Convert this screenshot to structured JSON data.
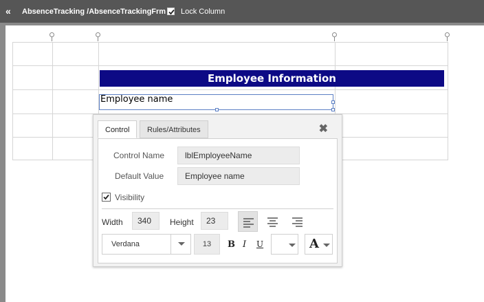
{
  "topbar": {
    "collapse_icon": "double-chevron-left-icon",
    "path": "AbsenceTracking /AbsenceTrackingFrm",
    "lock_column_label": "Lock Column",
    "lock_column_checked": true
  },
  "canvas": {
    "header_text": "Employee Information",
    "header_bg": "#0d0a85",
    "selected_label_text": "Employee name"
  },
  "popup": {
    "tabs": [
      {
        "label": "Control",
        "active": true
      },
      {
        "label": "Rules/Attributes",
        "active": false
      }
    ],
    "close_icon": "close-icon",
    "control_name_label": "Control Name",
    "control_name_value": "lblEmployeeName",
    "default_value_label": "Default Value",
    "default_value_value": "Employee name",
    "visibility_label": "Visibility",
    "visibility_checked": true,
    "width_label": "Width",
    "width_value": "340",
    "height_label": "Height",
    "height_value": "23",
    "alignment": "left",
    "font_family": "Verdana",
    "font_size": "13",
    "bold_label": "B",
    "italic_label": "I",
    "underline_label": "U",
    "font_color_label": "A"
  }
}
